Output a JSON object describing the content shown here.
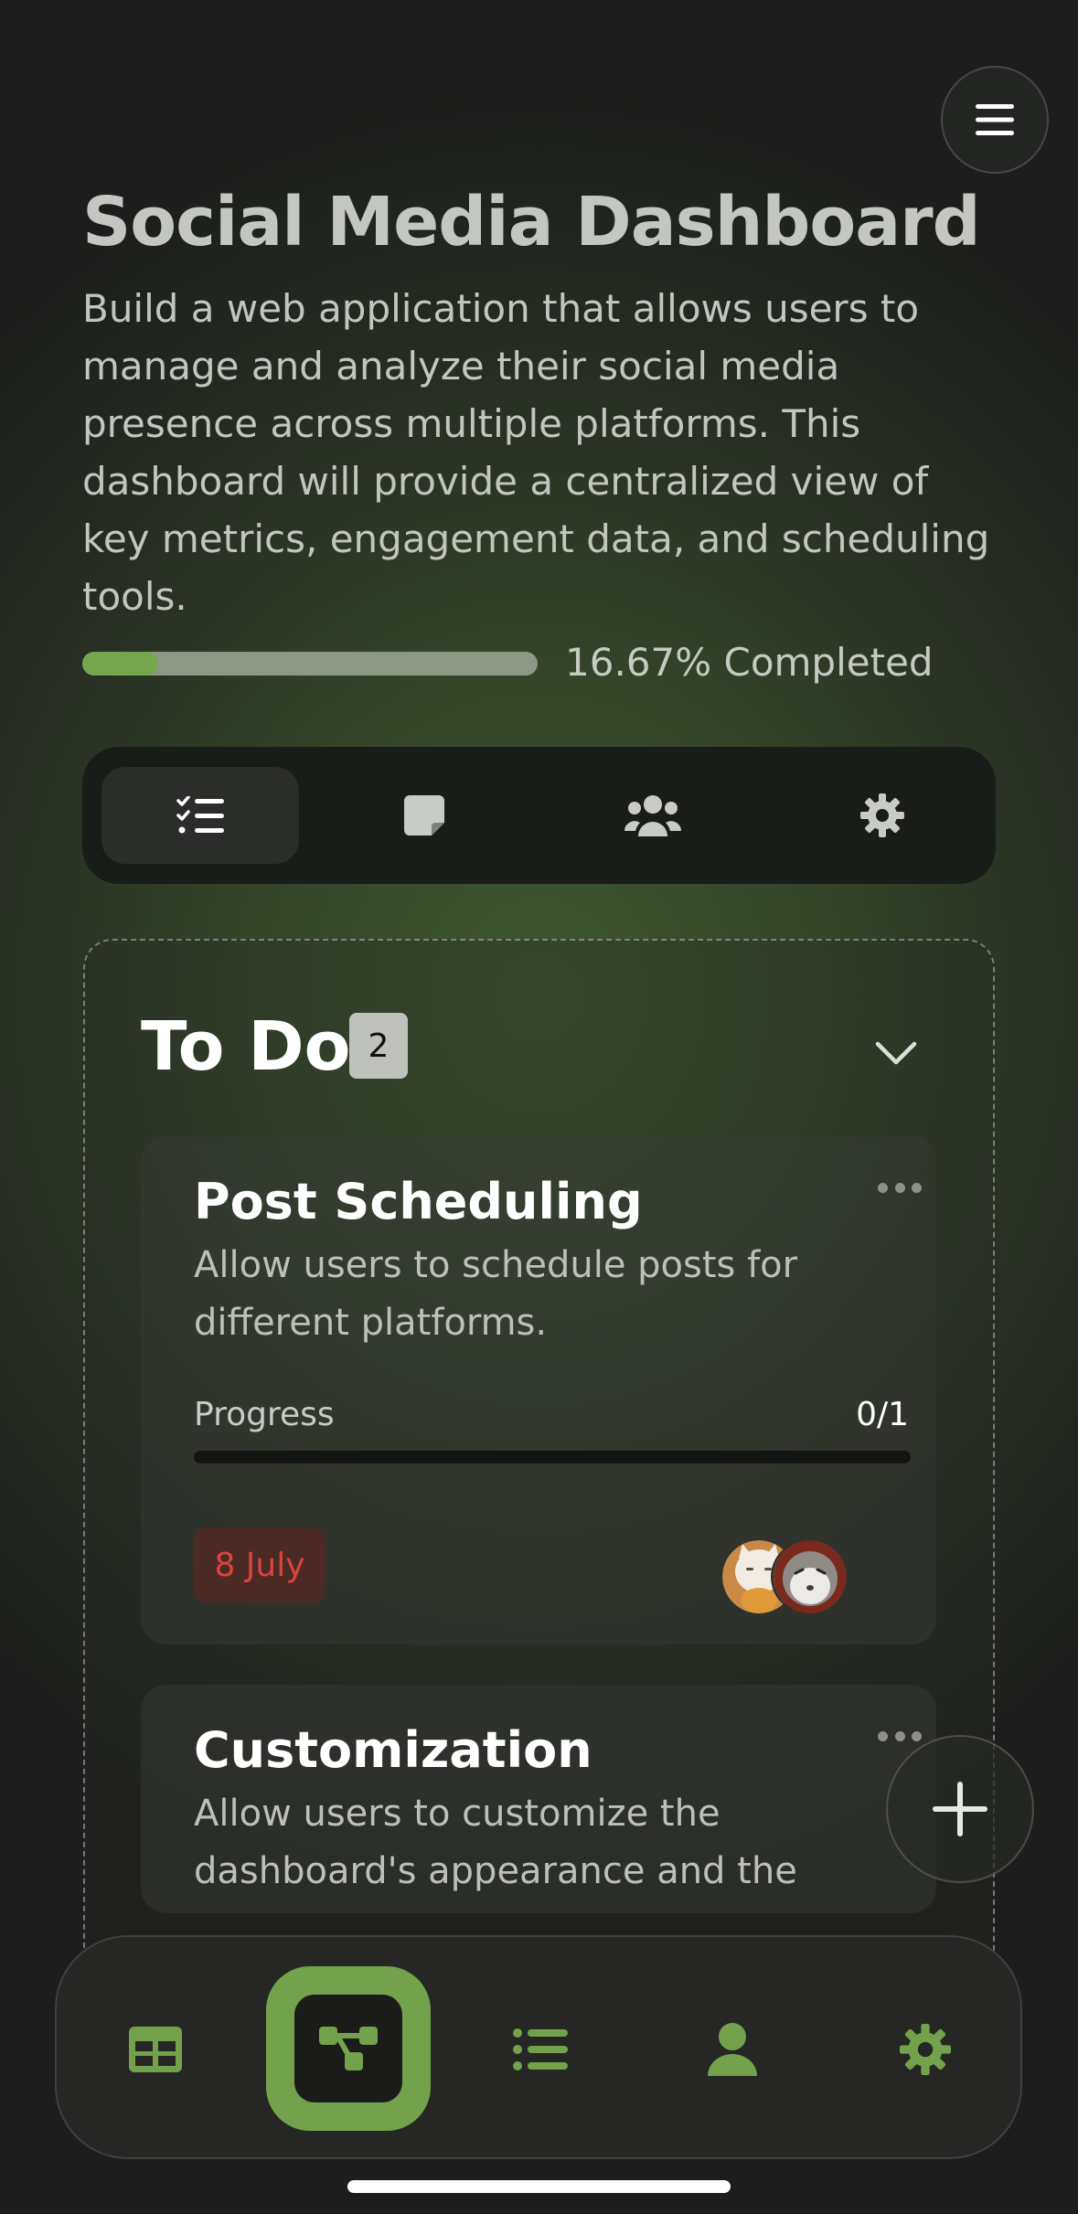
{
  "project": {
    "title": "Social Media Dashboard",
    "description": "Build a web application that allows users to manage and analyze their social media presence across multiple platforms. This dashboard will provide a centralized view of key metrics, engagement data, and scheduling tools.",
    "progress_fraction": 0.1667,
    "progress_label": "16.67% Completed"
  },
  "tabs": [
    {
      "icon": "checklist-icon",
      "active": true
    },
    {
      "icon": "note-icon",
      "active": false
    },
    {
      "icon": "users-icon",
      "active": false
    },
    {
      "icon": "gear-icon",
      "active": false
    }
  ],
  "column": {
    "title": "To Do",
    "count": "2",
    "collapse_icon": "chevron-down-icon"
  },
  "cards": [
    {
      "title": "Post Scheduling",
      "description": "Allow users to schedule posts for different platforms.",
      "progress_label": "Progress",
      "progress_value": "0/1",
      "progress_fraction": 0,
      "due_date": "8 July",
      "assignees": [
        "avatar-cat-white",
        "avatar-cat-grey"
      ]
    },
    {
      "title": "Customization",
      "description": "Allow users to customize the dashboard's appearance and the"
    }
  ],
  "bottom_nav": [
    {
      "icon": "table-icon",
      "active": false
    },
    {
      "icon": "flow-icon",
      "active": true
    },
    {
      "icon": "list-icon",
      "active": false
    },
    {
      "icon": "user-icon",
      "active": false
    },
    {
      "icon": "gear-icon",
      "active": false
    }
  ],
  "colors": {
    "accent": "#72a24b",
    "due_date": "#d9443c",
    "background": "#34452a"
  }
}
